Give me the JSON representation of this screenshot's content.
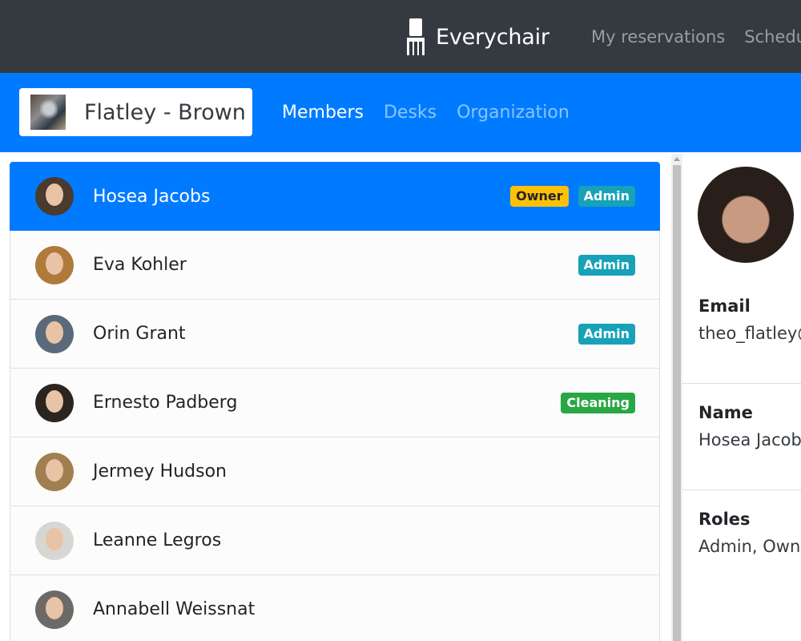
{
  "app": {
    "brand": "Everychair",
    "brand_icon": "chair-icon"
  },
  "topnav": {
    "items": [
      "My reservations",
      "Schedule"
    ]
  },
  "org": {
    "name": "Flatley - Brown"
  },
  "tabs": [
    {
      "label": "Members",
      "active": true
    },
    {
      "label": "Desks",
      "active": false
    },
    {
      "label": "Organization",
      "active": false
    }
  ],
  "members": [
    {
      "name": "Hosea Jacobs",
      "badges": [
        {
          "label": "Owner",
          "type": "owner"
        },
        {
          "label": "Admin",
          "type": "admin"
        }
      ],
      "active": true
    },
    {
      "name": "Eva Kohler",
      "badges": [
        {
          "label": "Admin",
          "type": "admin"
        }
      ]
    },
    {
      "name": "Orin Grant",
      "badges": [
        {
          "label": "Admin",
          "type": "admin"
        }
      ]
    },
    {
      "name": "Ernesto Padberg",
      "badges": [
        {
          "label": "Cleaning",
          "type": "cleaning"
        }
      ]
    },
    {
      "name": "Jermey Hudson",
      "badges": []
    },
    {
      "name": "Leanne Legros",
      "badges": []
    },
    {
      "name": "Annabell Weissnat",
      "badges": []
    }
  ],
  "detail": {
    "email_label": "Email",
    "email_value": "theo_flatley@",
    "name_label": "Name",
    "name_value": "Hosea Jacobs",
    "roles_label": "Roles",
    "roles_value": "Admin, Owner"
  },
  "colors": {
    "topbar": "#343a40",
    "primary": "#007bff",
    "owner": "#ffc107",
    "admin": "#17a2b8",
    "cleaning": "#28a745"
  }
}
